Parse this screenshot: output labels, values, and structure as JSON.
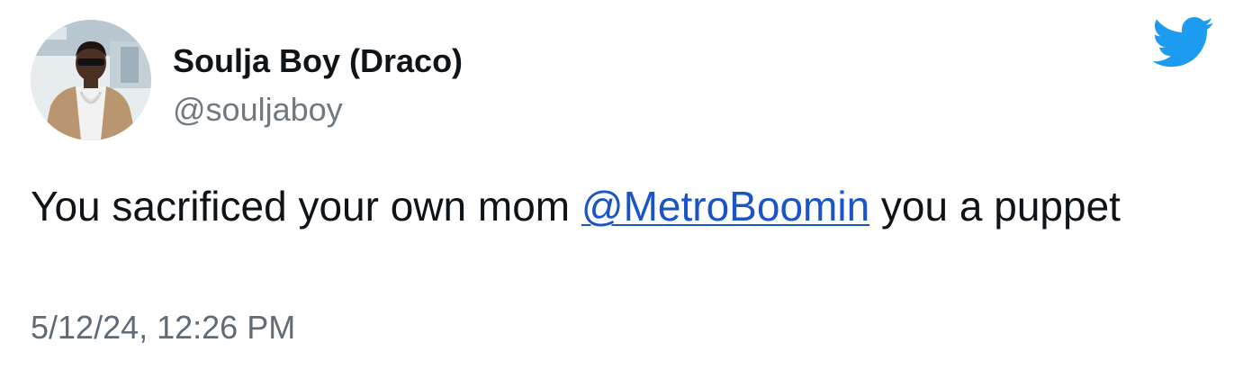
{
  "tweet": {
    "author": {
      "name": "Soulja Boy (Draco)",
      "handle": "@souljaboy",
      "avatar_icon": "profile-photo"
    },
    "logo_icon": "twitter-bird-icon",
    "text": {
      "before": "You sacrificed your own mom ",
      "mention": "@MetroBoomin",
      "after": " you a puppet"
    },
    "timestamp": "5/12/24, 12:26 PM"
  },
  "colors": {
    "brand": "#1d9bf0",
    "link": "#1a54c7",
    "text": "#0f1419",
    "secondary": "#707880"
  }
}
